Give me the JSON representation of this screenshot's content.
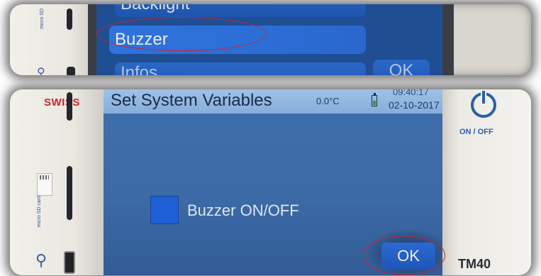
{
  "top_panel": {
    "menu_items": [
      {
        "label": "Backlight"
      },
      {
        "label": "Buzzer"
      },
      {
        "label": "Infos"
      }
    ],
    "ok_label": "OK",
    "sd_text": "micro SD"
  },
  "device": {
    "brand": "SWISS",
    "sd_label": "micro SD card",
    "power_label": "ON / OFF",
    "model": "TM40"
  },
  "screen": {
    "title": "Set System Variables",
    "temperature": "0.0°C",
    "time": "09:40:17",
    "date": "02-10-2017",
    "checkbox_label": "Buzzer ON/OFF",
    "ok_label": "OK"
  },
  "colors": {
    "screen_blue": "#3c6aa6",
    "button_blue": "#1f5cc4",
    "title_bar": "#9ec2e6",
    "highlight_red": "#d0222b",
    "brand_red": "#d2232a",
    "accent_blue": "#2c5ea8"
  },
  "icons": [
    "battery-icon",
    "power-icon",
    "usb-icon",
    "sd-card-icon"
  ]
}
